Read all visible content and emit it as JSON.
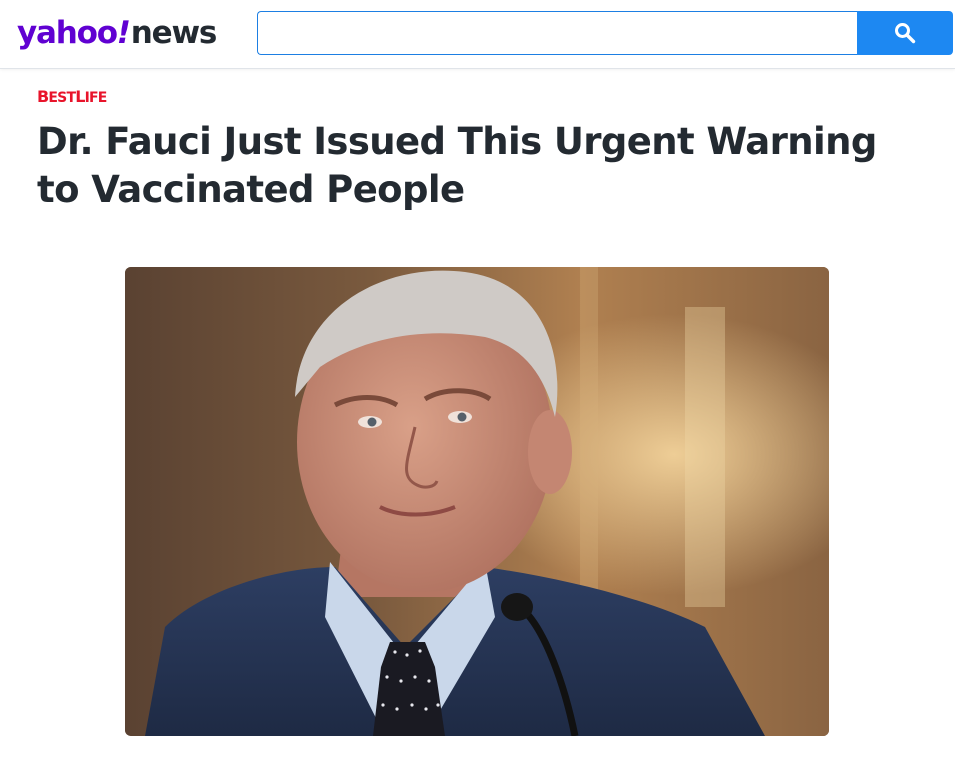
{
  "header": {
    "logo": {
      "brand": "yahoo",
      "bang": "!",
      "section": "news"
    },
    "search": {
      "value": "",
      "placeholder": "",
      "button_icon": "search-icon"
    }
  },
  "article": {
    "publisher": {
      "initial1": "B",
      "rest1": "EST",
      "initial2": "L",
      "rest2": "IFE"
    },
    "title": "Dr. Fauci Just Issued This Urgent Warning to Vaccinated People",
    "hero_image": {
      "subject": "photo-of-man-in-suit"
    }
  },
  "colors": {
    "brand_purple": "#6001d2",
    "search_blue": "#1d88f2",
    "publisher_red": "#e8142b",
    "headline_text": "#232a31"
  }
}
